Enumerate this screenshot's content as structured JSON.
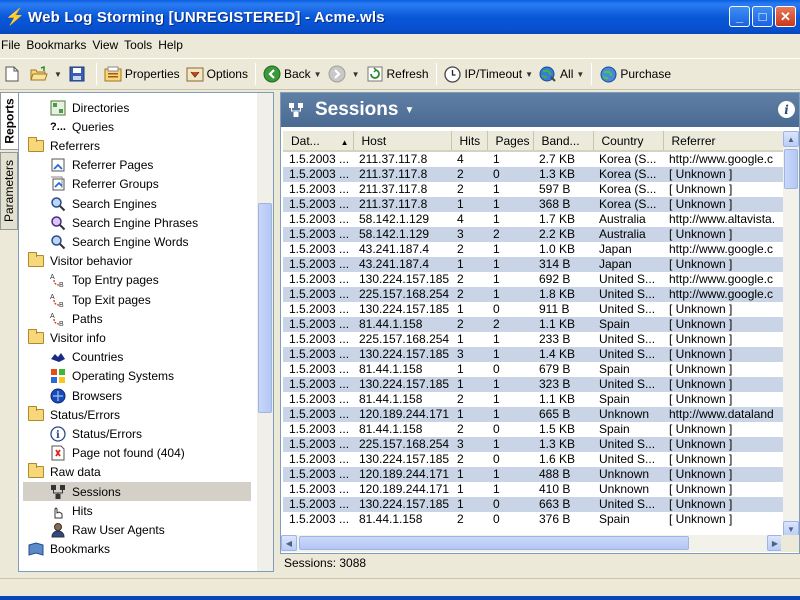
{
  "window": {
    "title": "Web Log Storming  [UNREGISTERED] - Acme.wls"
  },
  "menu": [
    "File",
    "Bookmarks",
    "View",
    "Tools",
    "Help"
  ],
  "toolbar": {
    "properties": "Properties",
    "options": "Options",
    "back": "Back",
    "refresh": "Refresh",
    "ip_timeout": "IP/Timeout",
    "all": "All",
    "purchase": "Purchase"
  },
  "vtabs": {
    "reports": "Reports",
    "parameters": "Parameters"
  },
  "tree": [
    {
      "label": "Directories",
      "level": 1,
      "icon": "directories-icon"
    },
    {
      "label": "Queries",
      "level": 1,
      "icon": "query-icon"
    },
    {
      "label": "Referrers",
      "level": 0,
      "icon": "folder-open-icon"
    },
    {
      "label": "Referrer Pages",
      "level": 1,
      "icon": "referrer-pages-icon"
    },
    {
      "label": "Referrer Groups",
      "level": 1,
      "icon": "referrer-groups-icon"
    },
    {
      "label": "Search Engines",
      "level": 1,
      "icon": "search-engines-icon"
    },
    {
      "label": "Search Engine Phrases",
      "level": 1,
      "icon": "search-phrases-icon"
    },
    {
      "label": "Search Engine Words",
      "level": 1,
      "icon": "search-words-icon"
    },
    {
      "label": "Visitor behavior",
      "level": 0,
      "icon": "folder-open-icon"
    },
    {
      "label": "Top Entry pages",
      "level": 1,
      "icon": "entry-pages-icon"
    },
    {
      "label": "Top Exit pages",
      "level": 1,
      "icon": "exit-pages-icon"
    },
    {
      "label": "Paths",
      "level": 1,
      "icon": "paths-icon"
    },
    {
      "label": "Visitor info",
      "level": 0,
      "icon": "folder-open-icon"
    },
    {
      "label": "Countries",
      "level": 1,
      "icon": "countries-icon"
    },
    {
      "label": "Operating Systems",
      "level": 1,
      "icon": "operating-systems-icon"
    },
    {
      "label": "Browsers",
      "level": 1,
      "icon": "browsers-icon"
    },
    {
      "label": "Status/Errors",
      "level": 0,
      "icon": "folder-open-icon"
    },
    {
      "label": "Status/Errors",
      "level": 1,
      "icon": "status-errors-icon"
    },
    {
      "label": "Page not found (404)",
      "level": 1,
      "icon": "page-not-found-icon"
    },
    {
      "label": "Raw data",
      "level": 0,
      "icon": "folder-open-icon"
    },
    {
      "label": "Sessions",
      "level": 1,
      "icon": "sessions-icon",
      "selected": true
    },
    {
      "label": "Hits",
      "level": 1,
      "icon": "hits-icon"
    },
    {
      "label": "Raw User Agents",
      "level": 1,
      "icon": "raw-user-agents-icon"
    },
    {
      "label": "Bookmarks",
      "level": 0,
      "icon": "bookmarks-icon"
    }
  ],
  "panel": {
    "title": "Sessions",
    "info": "i"
  },
  "columns": [
    "Dat...",
    "Host",
    "Hits",
    "Pages",
    "Band...",
    "Country",
    "Referrer"
  ],
  "rows": [
    [
      "1.5.2003 ...",
      "211.37.117.8",
      "4",
      "1",
      "2.7 KB",
      "Korea (S...",
      "http://www.google.c"
    ],
    [
      "1.5.2003 ...",
      "211.37.117.8",
      "2",
      "0",
      "1.3 KB",
      "Korea (S...",
      "[ Unknown ]"
    ],
    [
      "1.5.2003 ...",
      "211.37.117.8",
      "2",
      "1",
      "597 B",
      "Korea (S...",
      "[ Unknown ]"
    ],
    [
      "1.5.2003 ...",
      "211.37.117.8",
      "1",
      "1",
      "368 B",
      "Korea (S...",
      "[ Unknown ]"
    ],
    [
      "1.5.2003 ...",
      "58.142.1.129",
      "4",
      "1",
      "1.7 KB",
      "Australia",
      "http://www.altavista."
    ],
    [
      "1.5.2003 ...",
      "58.142.1.129",
      "3",
      "2",
      "2.2 KB",
      "Australia",
      "[ Unknown ]"
    ],
    [
      "1.5.2003 ...",
      "43.241.187.4",
      "2",
      "1",
      "1.0 KB",
      "Japan",
      "http://www.google.c"
    ],
    [
      "1.5.2003 ...",
      "43.241.187.4",
      "1",
      "1",
      "314 B",
      "Japan",
      "[ Unknown ]"
    ],
    [
      "1.5.2003 ...",
      "130.224.157.185",
      "2",
      "1",
      "692 B",
      "United S...",
      "http://www.google.c"
    ],
    [
      "1.5.2003 ...",
      "225.157.168.254",
      "2",
      "1",
      "1.8 KB",
      "United S...",
      "http://www.google.c"
    ],
    [
      "1.5.2003 ...",
      "130.224.157.185",
      "1",
      "0",
      "911 B",
      "United S...",
      "[ Unknown ]"
    ],
    [
      "1.5.2003 ...",
      "81.44.1.158",
      "2",
      "2",
      "1.1 KB",
      "Spain",
      "[ Unknown ]"
    ],
    [
      "1.5.2003 ...",
      "225.157.168.254",
      "1",
      "1",
      "233 B",
      "United S...",
      "[ Unknown ]"
    ],
    [
      "1.5.2003 ...",
      "130.224.157.185",
      "3",
      "1",
      "1.4 KB",
      "United S...",
      "[ Unknown ]"
    ],
    [
      "1.5.2003 ...",
      "81.44.1.158",
      "1",
      "0",
      "679 B",
      "Spain",
      "[ Unknown ]"
    ],
    [
      "1.5.2003 ...",
      "130.224.157.185",
      "1",
      "1",
      "323 B",
      "United S...",
      "[ Unknown ]"
    ],
    [
      "1.5.2003 ...",
      "81.44.1.158",
      "2",
      "1",
      "1.1 KB",
      "Spain",
      "[ Unknown ]"
    ],
    [
      "1.5.2003 ...",
      "120.189.244.171",
      "1",
      "1",
      "665 B",
      "Unknown",
      "http://www.dataland"
    ],
    [
      "1.5.2003 ...",
      "81.44.1.158",
      "2",
      "0",
      "1.5 KB",
      "Spain",
      "[ Unknown ]"
    ],
    [
      "1.5.2003 ...",
      "225.157.168.254",
      "3",
      "1",
      "1.3 KB",
      "United S...",
      "[ Unknown ]"
    ],
    [
      "1.5.2003 ...",
      "130.224.157.185",
      "2",
      "0",
      "1.6 KB",
      "United S...",
      "[ Unknown ]"
    ],
    [
      "1.5.2003 ...",
      "120.189.244.171",
      "1",
      "1",
      "488 B",
      "Unknown",
      "[ Unknown ]"
    ],
    [
      "1.5.2003 ...",
      "120.189.244.171",
      "1",
      "1",
      "410 B",
      "Unknown",
      "[ Unknown ]"
    ],
    [
      "1.5.2003 ...",
      "130.224.157.185",
      "1",
      "0",
      "663 B",
      "United S...",
      "[ Unknown ]"
    ],
    [
      "1.5.2003 ...",
      "81.44.1.158",
      "2",
      "0",
      "376 B",
      "Spain",
      "[ Unknown ]"
    ]
  ],
  "status": {
    "sessions": "Sessions: 3088"
  }
}
